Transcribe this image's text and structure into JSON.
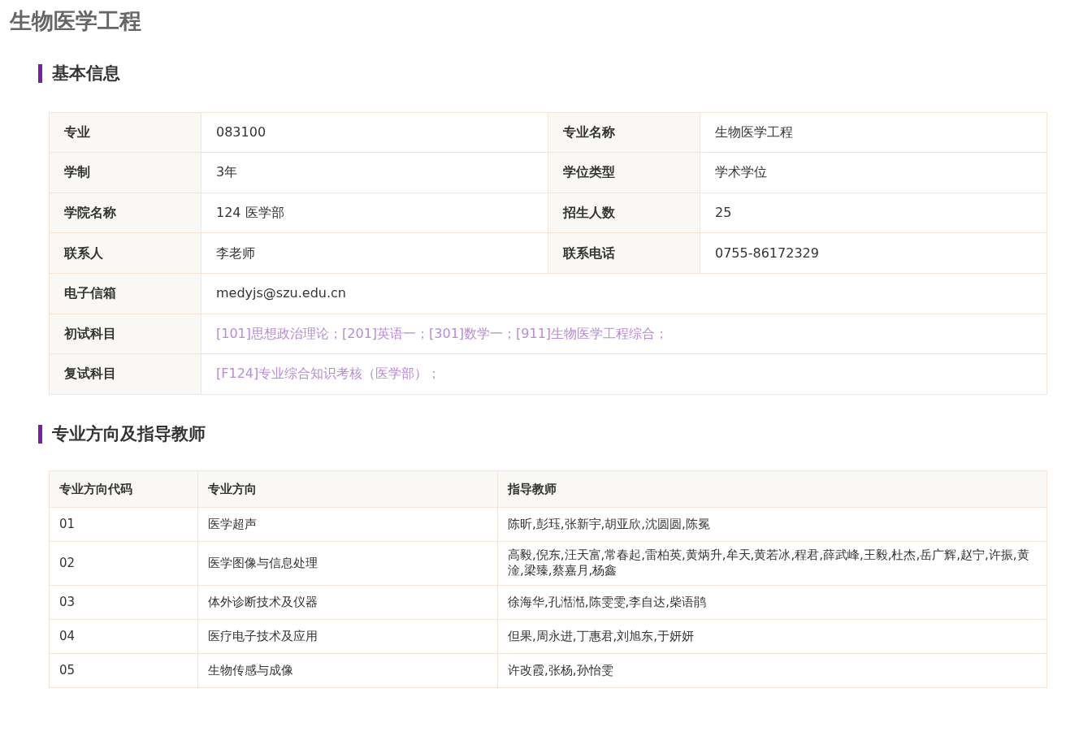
{
  "title": "生物医学工程",
  "sections": [
    {
      "heading": "基本信息"
    },
    {
      "heading": "专业方向及指导教师"
    }
  ],
  "info_rows": [
    {
      "cells": [
        {
          "label": "专业",
          "value": "083100",
          "kind": "text"
        },
        {
          "label": "专业名称",
          "value": "生物医学工程",
          "kind": "text"
        }
      ]
    },
    {
      "cells": [
        {
          "label": "学制",
          "value": "3年",
          "kind": "text"
        },
        {
          "label": "学位类型",
          "value": "学术学位",
          "kind": "text"
        }
      ]
    },
    {
      "cells": [
        {
          "label": "学院名称",
          "value": "124 医学部",
          "kind": "text"
        },
        {
          "label": "招生人数",
          "value": "25",
          "kind": "text"
        }
      ]
    },
    {
      "cells": [
        {
          "label": "联系人",
          "value": "李老师",
          "kind": "text"
        },
        {
          "label": "联系电话",
          "value": "0755-86172329",
          "kind": "text"
        }
      ]
    },
    {
      "cells": [
        {
          "label": "电子信箱",
          "value": "medyjs@szu.edu.cn",
          "kind": "text"
        }
      ]
    },
    {
      "cells": [
        {
          "label": "初试科目",
          "value": "[101]思想政治理论；[201]英语一；[301]数学一；[911]生物医学工程综合；",
          "kind": "link"
        }
      ]
    },
    {
      "cells": [
        {
          "label": "复试科目",
          "value": "[F124]专业综合知识考核（医学部）；",
          "kind": "link"
        }
      ]
    }
  ],
  "directions": {
    "columns": [
      "专业方向代码",
      "专业方向",
      "指导教师"
    ],
    "rows": [
      [
        "01",
        "医学超声",
        "陈昕,彭珏,张新宇,胡亚欣,沈圆圆,陈冕"
      ],
      [
        "02",
        "医学图像与信息处理",
        "高毅,倪东,汪天富,常春起,雷柏英,黄炳升,牟天,黄若冰,程君,薛武峰,王毅,杜杰,岳广辉,赵宁,许振,黄淦,梁臻,蔡嘉月,杨鑫"
      ],
      [
        "03",
        "体外诊断技术及仪器",
        "徐海华,孔湉湉,陈雯雯,李自达,柴语鹃"
      ],
      [
        "04",
        "医疗电子技术及应用",
        "但果,周永进,丁惠君,刘旭东,于妍妍"
      ],
      [
        "05",
        "生物传感与成像",
        "许改霞,张杨,孙怡雯"
      ]
    ]
  }
}
